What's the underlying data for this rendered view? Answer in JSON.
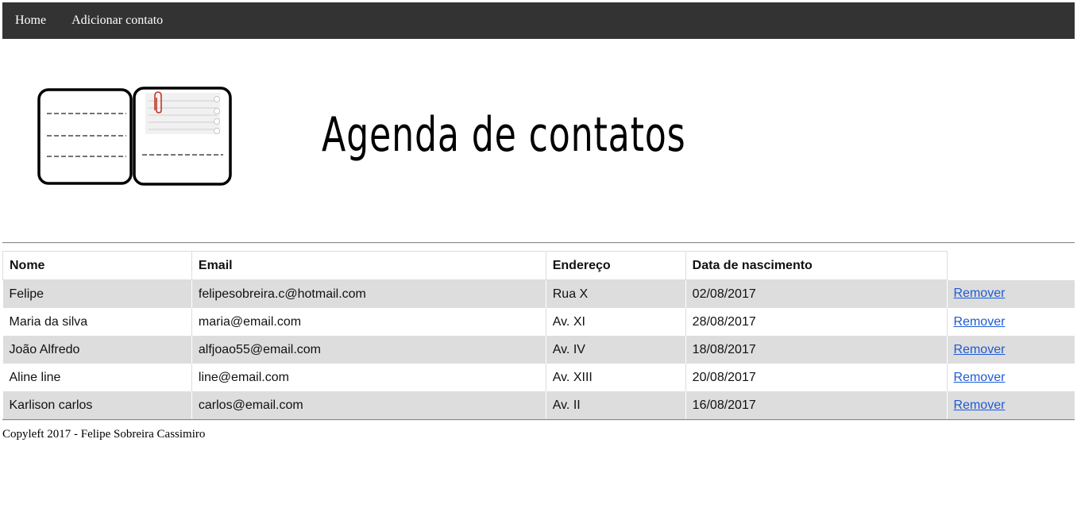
{
  "nav": {
    "home": "Home",
    "add_contact": "Adicionar contato"
  },
  "header": {
    "title": "Agenda de contatos",
    "logo_icon": "address-book-icon"
  },
  "table": {
    "headers": {
      "name": "Nome",
      "email": "Email",
      "address": "Endereço",
      "birthdate": "Data de nascimento"
    },
    "rows": [
      {
        "name": "Felipe",
        "email": "felipesobreira.c@hotmail.com",
        "address": "Rua X",
        "birthdate": "02/08/2017",
        "action": "Remover"
      },
      {
        "name": "Maria da silva",
        "email": "maria@email.com",
        "address": "Av. XI",
        "birthdate": "28/08/2017",
        "action": "Remover"
      },
      {
        "name": "João Alfredo",
        "email": "alfjoao55@email.com",
        "address": "Av. IV",
        "birthdate": "18/08/2017",
        "action": "Remover"
      },
      {
        "name": "Aline line",
        "email": "line@email.com",
        "address": "Av. XIII",
        "birthdate": "20/08/2017",
        "action": "Remover"
      },
      {
        "name": "Karlison carlos",
        "email": "carlos@email.com",
        "address": "Av. II",
        "birthdate": "16/08/2017",
        "action": "Remover"
      }
    ]
  },
  "footer": {
    "text": "Copyleft 2017 - Felipe Sobreira Cassimiro"
  },
  "colors": {
    "navbar_bg": "#333333",
    "row_stripe": "#dddddd",
    "link": "#1e5bd6"
  }
}
